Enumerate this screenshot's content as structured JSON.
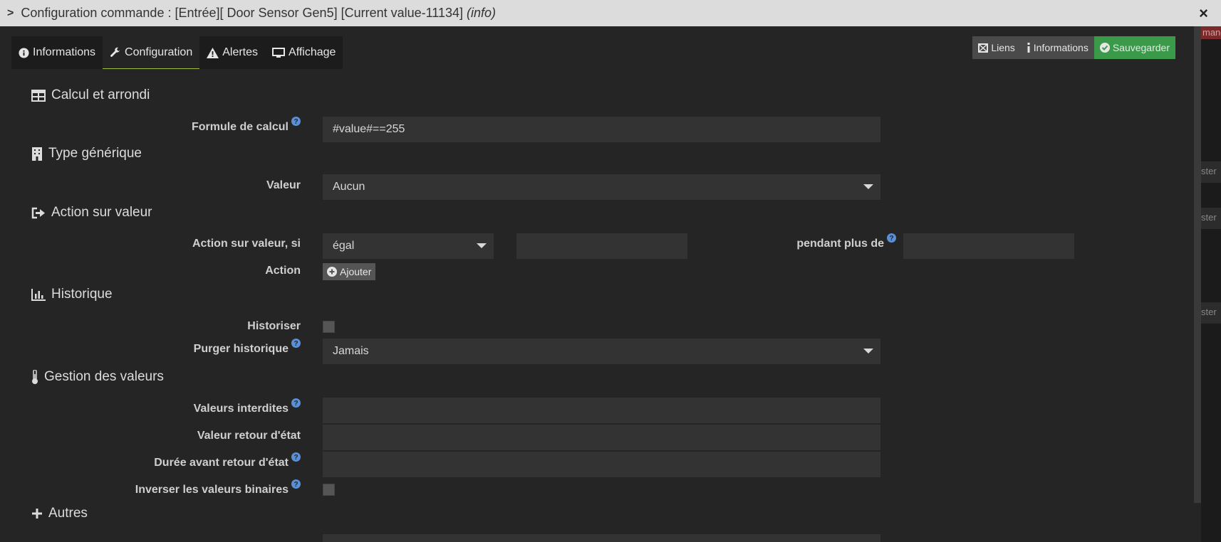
{
  "window": {
    "title": "Configuration commande : [Entrée][ Door Sensor Gen5] [Current value-11134]",
    "title_suffix": "(info)",
    "close_symbol": "×"
  },
  "background": {
    "red_text": "mand",
    "row_text": "ster"
  },
  "tabs": [
    {
      "label": "Informations",
      "icon": "info-circle-icon"
    },
    {
      "label": "Configuration",
      "icon": "wrench-icon"
    },
    {
      "label": "Alertes",
      "icon": "warning-icon"
    },
    {
      "label": "Affichage",
      "icon": "monitor-icon"
    }
  ],
  "toolbar": {
    "links_label": "Liens",
    "info_label": "Informations",
    "save_label": "Sauvegarder"
  },
  "sections": {
    "calc": "Calcul et arrondi",
    "generic": "Type générique",
    "action": "Action sur valeur",
    "history": "Historique",
    "values": "Gestion des valeurs",
    "other": "Autres"
  },
  "fields": {
    "formula_label": "Formule de calcul",
    "formula_value": "#value#==255",
    "valeur_label": "Valeur",
    "valeur_value": "Aucun",
    "action_if_label": "Action sur valeur, si",
    "action_if_value": "égal",
    "action_if_compare": "",
    "pendant_label": "pendant plus de",
    "pendant_value": "",
    "action_label": "Action",
    "add_label": "Ajouter",
    "historiser_label": "Historiser",
    "purge_label": "Purger historique",
    "purge_value": "Jamais",
    "forbidden_label": "Valeurs interdites",
    "forbidden_value": "",
    "return_label": "Valeur retour d'état",
    "return_value": "",
    "duration_label": "Durée avant retour d'état",
    "duration_value": "",
    "invert_label": "Inverser les valeurs binaires"
  },
  "colors": {
    "accent_tab": "#9fbe3e",
    "save_button": "#3a9a4a",
    "help_icon": "#5b8fd6"
  }
}
